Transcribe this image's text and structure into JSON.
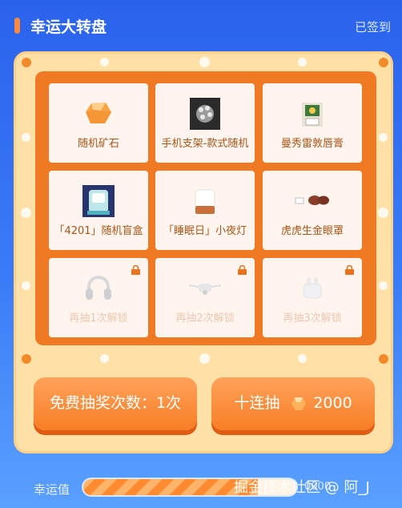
{
  "header": {
    "title": "幸运大转盘",
    "signed_label": "已签到"
  },
  "prizes": [
    {
      "label": "随机矿石",
      "icon": "ore-icon",
      "locked": false
    },
    {
      "label": "手机支架-款式随机",
      "icon": "phone-holder-icon",
      "locked": false
    },
    {
      "label": "曼秀雷敦唇膏",
      "icon": "lip-balm-icon",
      "locked": false
    },
    {
      "label": "「4201」随机盲盒",
      "icon": "blind-box-icon",
      "locked": false
    },
    {
      "label": "「睡眠日」小夜灯",
      "icon": "night-lamp-icon",
      "locked": false
    },
    {
      "label": "虎虎生金眼罩",
      "icon": "eye-mask-icon",
      "locked": false
    },
    {
      "label": "再抽1次解锁",
      "icon": "headphones-icon",
      "locked": true
    },
    {
      "label": "再抽2次解锁",
      "icon": "camera-drone-icon",
      "locked": true
    },
    {
      "label": "再抽3次解锁",
      "icon": "earbuds-icon",
      "locked": true
    }
  ],
  "buttons": {
    "free_draw_label": "免费抽奖次数：1次",
    "ten_draw_label": "十连抽",
    "ten_draw_cost": "2000"
  },
  "luck": {
    "label": "幸运值",
    "progress_fraction": 0.82,
    "count_text": "0000"
  },
  "watermark": "掘金技术社区 @ 阿_J",
  "colors": {
    "background": "#2f6ef0",
    "board": "#ffe0a6",
    "grid_frame": "#ef7a23",
    "button": "#f77e25",
    "prize_text": "#a6561a"
  }
}
